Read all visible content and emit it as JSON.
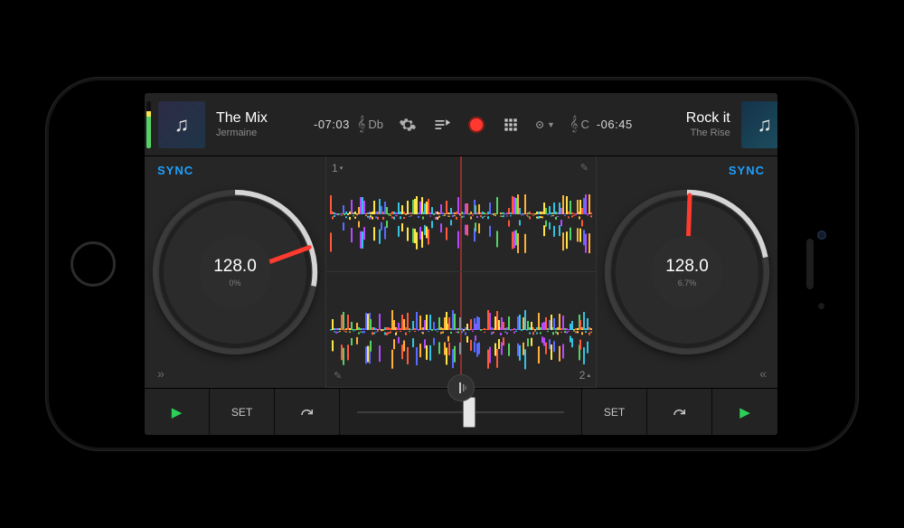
{
  "decks": {
    "left": {
      "title": "The Mix",
      "artist": "Jermaine",
      "time": "-07:03",
      "key": "Db",
      "bpm": "128.0",
      "pitch": "0%",
      "sync": "SYNC",
      "needle_angle": -20,
      "progress_pct": 28,
      "level_pct": 78
    },
    "right": {
      "title": "Rock it",
      "artist": "The Rise",
      "time": "-06:45",
      "key": "C",
      "bpm": "128.0",
      "pitch": "6.7%",
      "sync": "SYNC",
      "needle_angle": -88,
      "progress_pct": 22,
      "level_pct": 72
    }
  },
  "lanes": {
    "top_num": "1",
    "bottom_num": "2"
  },
  "buttons": {
    "set": "SET",
    "play_glyph": "▶",
    "expand_left": "»",
    "expand_right": "«"
  },
  "crossfader": {
    "position_pct": 54
  },
  "colors": {
    "accent_red": "#ff3b30",
    "accent_green": "#2bd157",
    "sync_blue": "#1da0ff"
  },
  "chart_data": {
    "type": "waveform-preview",
    "note": "decorative multicolor audio waveforms; no numeric axes"
  }
}
